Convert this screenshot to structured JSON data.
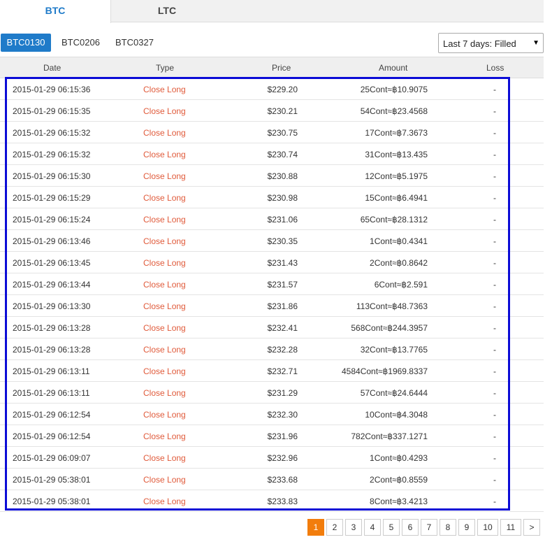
{
  "tabs": [
    {
      "label": "BTC",
      "active": true
    },
    {
      "label": "LTC",
      "active": false
    }
  ],
  "contracts": [
    {
      "label": "BTC0130",
      "active": true
    },
    {
      "label": "BTC0206",
      "active": false
    },
    {
      "label": "BTC0327",
      "active": false
    }
  ],
  "filter": {
    "selected": "Last 7 days: Filled"
  },
  "table": {
    "headers": {
      "date": "Date",
      "type": "Type",
      "price": "Price",
      "amount": "Amount",
      "loss": "Loss"
    },
    "rows": [
      {
        "date": "2015-01-29 06:15:36",
        "type": "Close Long",
        "price": "$229.20",
        "amount": "25Cont≈฿10.9075",
        "loss": "-"
      },
      {
        "date": "2015-01-29 06:15:35",
        "type": "Close Long",
        "price": "$230.21",
        "amount": "54Cont≈฿23.4568",
        "loss": "-"
      },
      {
        "date": "2015-01-29 06:15:32",
        "type": "Close Long",
        "price": "$230.75",
        "amount": "17Cont≈฿7.3673",
        "loss": "-"
      },
      {
        "date": "2015-01-29 06:15:32",
        "type": "Close Long",
        "price": "$230.74",
        "amount": "31Cont≈฿13.435",
        "loss": "-"
      },
      {
        "date": "2015-01-29 06:15:30",
        "type": "Close Long",
        "price": "$230.88",
        "amount": "12Cont≈฿5.1975",
        "loss": "-"
      },
      {
        "date": "2015-01-29 06:15:29",
        "type": "Close Long",
        "price": "$230.98",
        "amount": "15Cont≈฿6.4941",
        "loss": "-"
      },
      {
        "date": "2015-01-29 06:15:24",
        "type": "Close Long",
        "price": "$231.06",
        "amount": "65Cont≈฿28.1312",
        "loss": "-"
      },
      {
        "date": "2015-01-29 06:13:46",
        "type": "Close Long",
        "price": "$230.35",
        "amount": "1Cont≈฿0.4341",
        "loss": "-"
      },
      {
        "date": "2015-01-29 06:13:45",
        "type": "Close Long",
        "price": "$231.43",
        "amount": "2Cont≈฿0.8642",
        "loss": "-"
      },
      {
        "date": "2015-01-29 06:13:44",
        "type": "Close Long",
        "price": "$231.57",
        "amount": "6Cont≈฿2.591",
        "loss": "-"
      },
      {
        "date": "2015-01-29 06:13:30",
        "type": "Close Long",
        "price": "$231.86",
        "amount": "113Cont≈฿48.7363",
        "loss": "-"
      },
      {
        "date": "2015-01-29 06:13:28",
        "type": "Close Long",
        "price": "$232.41",
        "amount": "568Cont≈฿244.3957",
        "loss": "-"
      },
      {
        "date": "2015-01-29 06:13:28",
        "type": "Close Long",
        "price": "$232.28",
        "amount": "32Cont≈฿13.7765",
        "loss": "-"
      },
      {
        "date": "2015-01-29 06:13:11",
        "type": "Close Long",
        "price": "$232.71",
        "amount": "4584Cont≈฿1969.8337",
        "loss": "-"
      },
      {
        "date": "2015-01-29 06:13:11",
        "type": "Close Long",
        "price": "$231.29",
        "amount": "57Cont≈฿24.6444",
        "loss": "-"
      },
      {
        "date": "2015-01-29 06:12:54",
        "type": "Close Long",
        "price": "$232.30",
        "amount": "10Cont≈฿4.3048",
        "loss": "-"
      },
      {
        "date": "2015-01-29 06:12:54",
        "type": "Close Long",
        "price": "$231.96",
        "amount": "782Cont≈฿337.1271",
        "loss": "-"
      },
      {
        "date": "2015-01-29 06:09:07",
        "type": "Close Long",
        "price": "$232.96",
        "amount": "1Cont≈฿0.4293",
        "loss": "-"
      },
      {
        "date": "2015-01-29 05:38:01",
        "type": "Close Long",
        "price": "$233.68",
        "amount": "2Cont≈฿0.8559",
        "loss": "-"
      },
      {
        "date": "2015-01-29 05:38:01",
        "type": "Close Long",
        "price": "$233.83",
        "amount": "8Cont≈฿3.4213",
        "loss": "-"
      }
    ]
  },
  "pagination": {
    "pages": [
      "1",
      "2",
      "3",
      "4",
      "5",
      "6",
      "7",
      "8",
      "9",
      "10",
      "11"
    ],
    "current": "1",
    "next_label": ">"
  },
  "colors": {
    "accent": "#1f7bc9",
    "close_long": "#e05a3a",
    "highlight_border": "#0c0cd6",
    "pager_active": "#f27d0c"
  }
}
